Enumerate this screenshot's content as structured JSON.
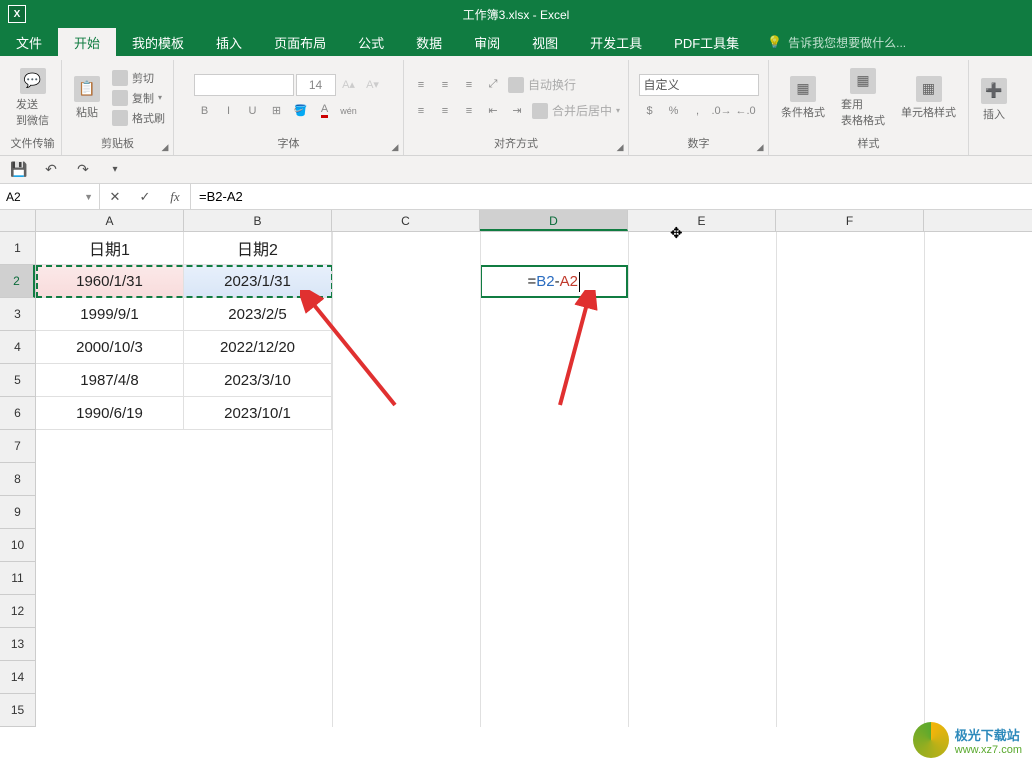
{
  "titlebar": {
    "title": "工作簿3.xlsx - Excel"
  },
  "tabs": {
    "items": [
      "文件",
      "开始",
      "我的模板",
      "插入",
      "页面布局",
      "公式",
      "数据",
      "审阅",
      "视图",
      "开发工具",
      "PDF工具集"
    ],
    "active_index": 1,
    "tell_me": "告诉我您想要做什么..."
  },
  "ribbon": {
    "groups": {
      "file_transfer": {
        "label": "文件传输",
        "btn": "发送\n到微信"
      },
      "clipboard": {
        "label": "剪贴板",
        "paste": "粘贴",
        "cut": "剪切",
        "copy": "复制",
        "format_painter": "格式刷"
      },
      "font": {
        "label": "字体",
        "size": "14",
        "btns": [
          "B",
          "I",
          "U"
        ]
      },
      "alignment": {
        "label": "对齐方式",
        "wrap": "自动换行",
        "merge": "合并后居中"
      },
      "number": {
        "label": "数字",
        "format": "自定义"
      },
      "styles": {
        "label": "样式",
        "cond": "条件格式",
        "table": "套用\n表格格式",
        "cell": "单元格样式"
      },
      "insert": {
        "label": "",
        "btn": "插入"
      }
    }
  },
  "formula_bar": {
    "name_box": "A2",
    "formula": "=B2-A2"
  },
  "grid": {
    "columns": [
      "A",
      "B",
      "C",
      "D",
      "E",
      "F"
    ],
    "rows": [
      "1",
      "2",
      "3",
      "4",
      "5",
      "6",
      "7",
      "8",
      "9",
      "10",
      "11",
      "12",
      "13",
      "14",
      "15"
    ],
    "data": {
      "A1": "日期1",
      "B1": "日期2",
      "A2": "1960/1/31",
      "B2": "2023/1/31",
      "A3": "1999/9/1",
      "B3": "2023/2/5",
      "A4": "2000/10/3",
      "B4": "2022/12/20",
      "A5": "1987/4/8",
      "B5": "2023/3/10",
      "A6": "1990/6/19",
      "B6": "2023/10/1"
    },
    "active_formula": {
      "eq": "=",
      "ref1": "B2",
      "op": "-",
      "ref2": "A2"
    }
  },
  "watermark": {
    "line1": "极光下载站",
    "line2": "www.xz7.com"
  }
}
